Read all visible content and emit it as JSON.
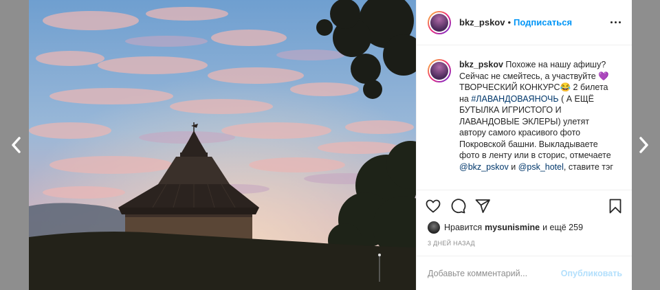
{
  "post": {
    "username": "bkz_pskov",
    "dot": "•",
    "follow_label": "Подписаться",
    "caption": {
      "username": "bkz_pskov",
      "part1": " Похоже на нашу афишу? Сейчас не смейтесь, а участвуйте 💜 ТВОРЧЕСКИЙ КОНКУРС😂 2 билета на ",
      "tag1": "#ЛАВАНДОВАЯНОЧЬ",
      "part2": " ( А ЕЩЁ БУТЫЛКА ИГРИСТОГО И ЛАВАНДОВЫЕ ЭКЛЕРЫ) улетят автору самого красивого фото Покровской башни. Выкладываете фото в ленту или в сторис, отмечаете ",
      "mention1": "@bkz_pskov",
      "part3": " и ",
      "mention2": "@psk_hotel",
      "part4": ", ставите тэг"
    },
    "likes": {
      "prefix": "Нравится",
      "user": "mysunismine",
      "suffix": "и ещё 259"
    },
    "date": "3 ДНЕЙ НАЗАД",
    "comment_placeholder": "Добавьте комментарий...",
    "post_label": "Опубликовать"
  },
  "icons": {
    "prev": "chevron-left-icon",
    "next": "chevron-right-icon",
    "like": "heart-icon",
    "comment": "comment-icon",
    "share": "paper-plane-icon",
    "save": "bookmark-icon",
    "more": "more-horizontal-icon"
  },
  "colors": {
    "accent": "#0095f6",
    "post_disabled": "#b2dffc",
    "backdrop": "#8e8e8e"
  }
}
